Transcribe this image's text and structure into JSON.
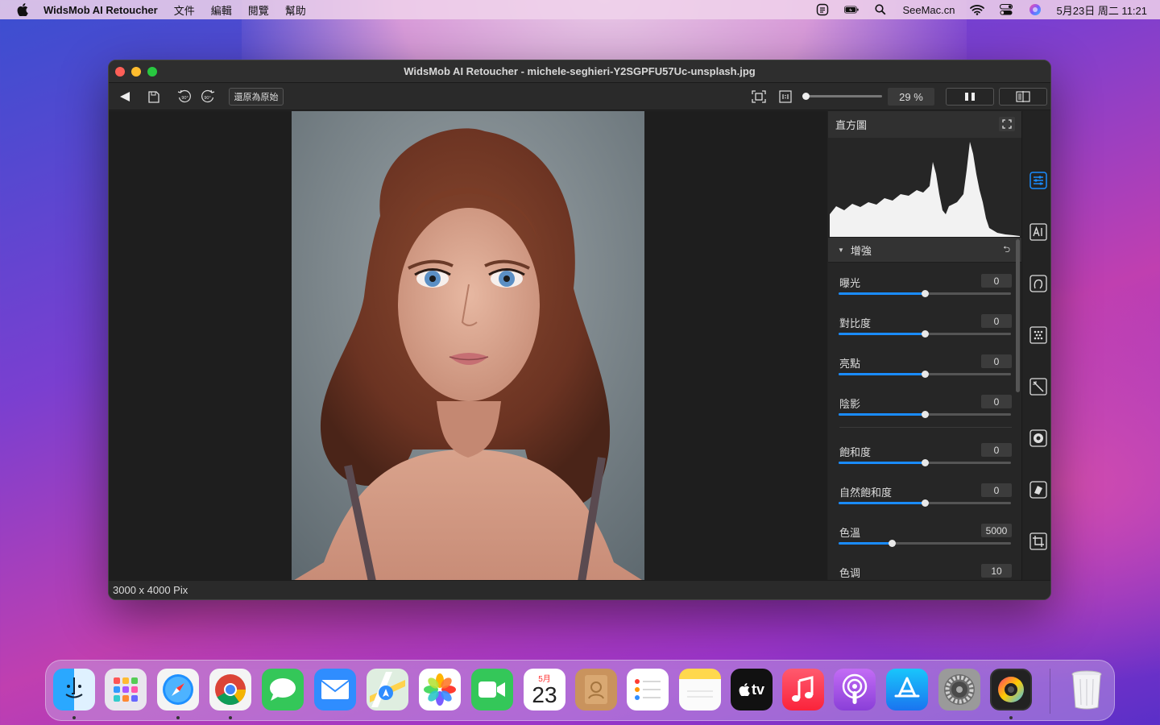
{
  "menubar": {
    "app_name": "WidsMob AI Retoucher",
    "menus": [
      "文件",
      "編輯",
      "閱覽",
      "幫助"
    ],
    "site": "SeeMac.cn",
    "clock": "5月23日 周二  11:21"
  },
  "window": {
    "title": "WidsMob AI Retoucher - michele-seghieri-Y2SGPFU57Uc-unsplash.jpg"
  },
  "toolbar": {
    "restore_label": "還原為原始",
    "rotate_left_label": "90°",
    "rotate_right_label": "90°",
    "zoom_percent": "29 %",
    "zoom_level": 0.03
  },
  "panel": {
    "histogram_title": "直方圖",
    "section_title": "增強",
    "adjustments": [
      {
        "label": "曝光",
        "value": "0",
        "pos": 0.5
      },
      {
        "label": "對比度",
        "value": "0",
        "pos": 0.5
      },
      {
        "label": "亮點",
        "value": "0",
        "pos": 0.5
      },
      {
        "label": "陰影",
        "value": "0",
        "pos": 0.5
      },
      {
        "label": "飽和度",
        "value": "0",
        "pos": 0.5
      },
      {
        "label": "自然飽和度",
        "value": "0",
        "pos": 0.5
      },
      {
        "label": "色溫",
        "value": "5000",
        "pos": 0.31
      },
      {
        "label": "色调",
        "value": "10",
        "pos": 0.5
      }
    ]
  },
  "status": {
    "dimensions": "3000 x 4000 Pix"
  },
  "dock": {
    "calendar_month": "5月",
    "calendar_day": "23",
    "appletv_label": "tv"
  },
  "colors": {
    "accent": "#1a8cff",
    "panel_bg": "#262626"
  }
}
